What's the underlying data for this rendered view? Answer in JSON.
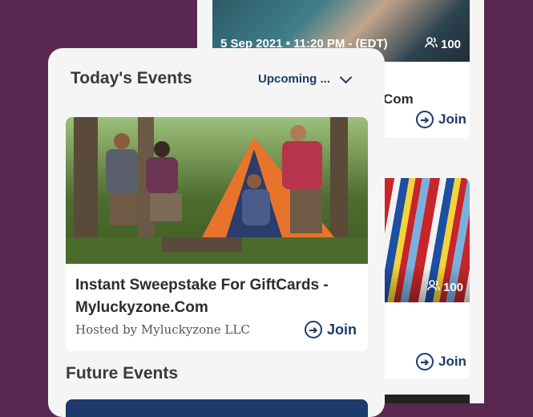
{
  "background": {
    "card1": {
      "datetime": "5 Sep 2021 • 11:20 PM - (EDT)",
      "attendees": "100",
      "title_tail": "Com",
      "join_label": "Join"
    },
    "card2": {
      "attendees": "100",
      "join_label": "Join"
    }
  },
  "today": {
    "heading": "Today's Events",
    "filter_label": "Upcoming ...",
    "event": {
      "title": "Instant Sweepstake For GiftCards - Myluckyzone.Com",
      "host": "Hosted by Myluckyzone LLC",
      "join_label": "Join"
    }
  },
  "future": {
    "heading": "Future Events"
  },
  "colors": {
    "background": "#5a2750",
    "accent": "#1e3a6b",
    "panel": "#f5f5f6"
  }
}
